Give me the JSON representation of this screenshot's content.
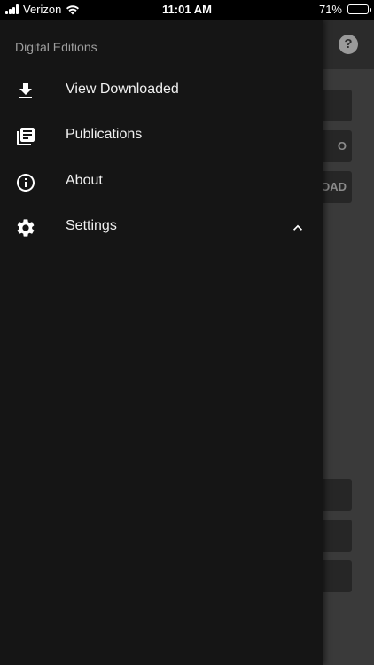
{
  "status_bar": {
    "carrier": "Verizon",
    "time": "11:01 AM",
    "battery_percent": "71%",
    "battery_level": 0.71,
    "icons": [
      "signal-icon",
      "wifi-icon",
      "battery-icon"
    ]
  },
  "background": {
    "help_glyph": "?",
    "buttons": [
      "",
      "O",
      "OAD",
      "",
      "",
      ""
    ]
  },
  "drawer": {
    "title": "Digital Editions",
    "items": [
      {
        "label": "View Downloaded",
        "icon": "download-icon"
      },
      {
        "label": "Publications",
        "icon": "publications-icon"
      },
      {
        "label": "About",
        "icon": "info-icon"
      },
      {
        "label": "Settings",
        "icon": "gear-icon",
        "expanded": true
      }
    ]
  },
  "colors": {
    "drawer_bg": "#151515",
    "text": "#f0f0f0",
    "title": "#9e9e9e"
  }
}
